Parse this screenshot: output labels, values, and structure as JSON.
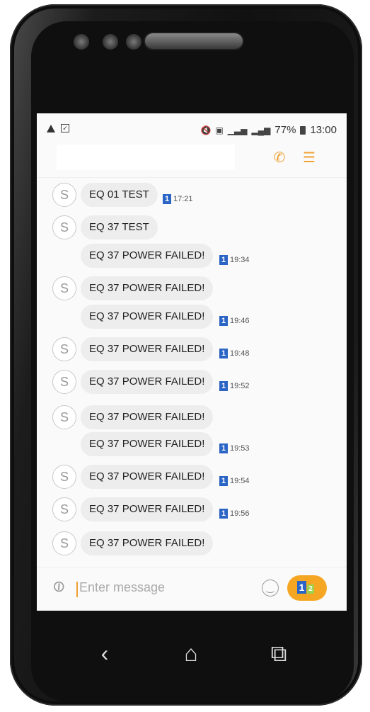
{
  "status_bar": {
    "battery": "77%",
    "time": "13:00"
  },
  "header": {
    "call_icon": "phone-icon",
    "menu_icon": "menu-icon"
  },
  "avatar_letter": "S",
  "messages": [
    {
      "text": "EQ 01 TEST",
      "time": "17:21",
      "unread": "1"
    },
    {
      "text": "EQ 37 TEST"
    },
    {
      "text": "EQ 37 POWER FAILED!",
      "time": "19:34",
      "unread": "1"
    },
    {
      "text": "EQ 37 POWER FAILED!"
    },
    {
      "text": "EQ 37 POWER FAILED!",
      "time": "19:46",
      "unread": "1"
    },
    {
      "text": "EQ 37 POWER FAILED!",
      "time": "19:48",
      "unread": "1"
    },
    {
      "text": "EQ 37 POWER FAILED!",
      "time": "19:52",
      "unread": "1"
    },
    {
      "text": "EQ 37 POWER FAILED!"
    },
    {
      "text": "EQ 37 POWER FAILED!",
      "time": "19:53",
      "unread": "1"
    },
    {
      "text": "EQ 37 POWER FAILED!",
      "time": "19:54",
      "unread": "1"
    },
    {
      "text": "EQ 37 POWER FAILED!",
      "time": "19:56",
      "unread": "1"
    },
    {
      "text": "EQ 37 POWER FAILED!"
    }
  ],
  "composer": {
    "placeholder": "Enter message",
    "send_sim1": "1",
    "send_sim2": "2"
  },
  "colors": {
    "accent": "#f5a623",
    "sim_badge": "#2a64c5"
  }
}
